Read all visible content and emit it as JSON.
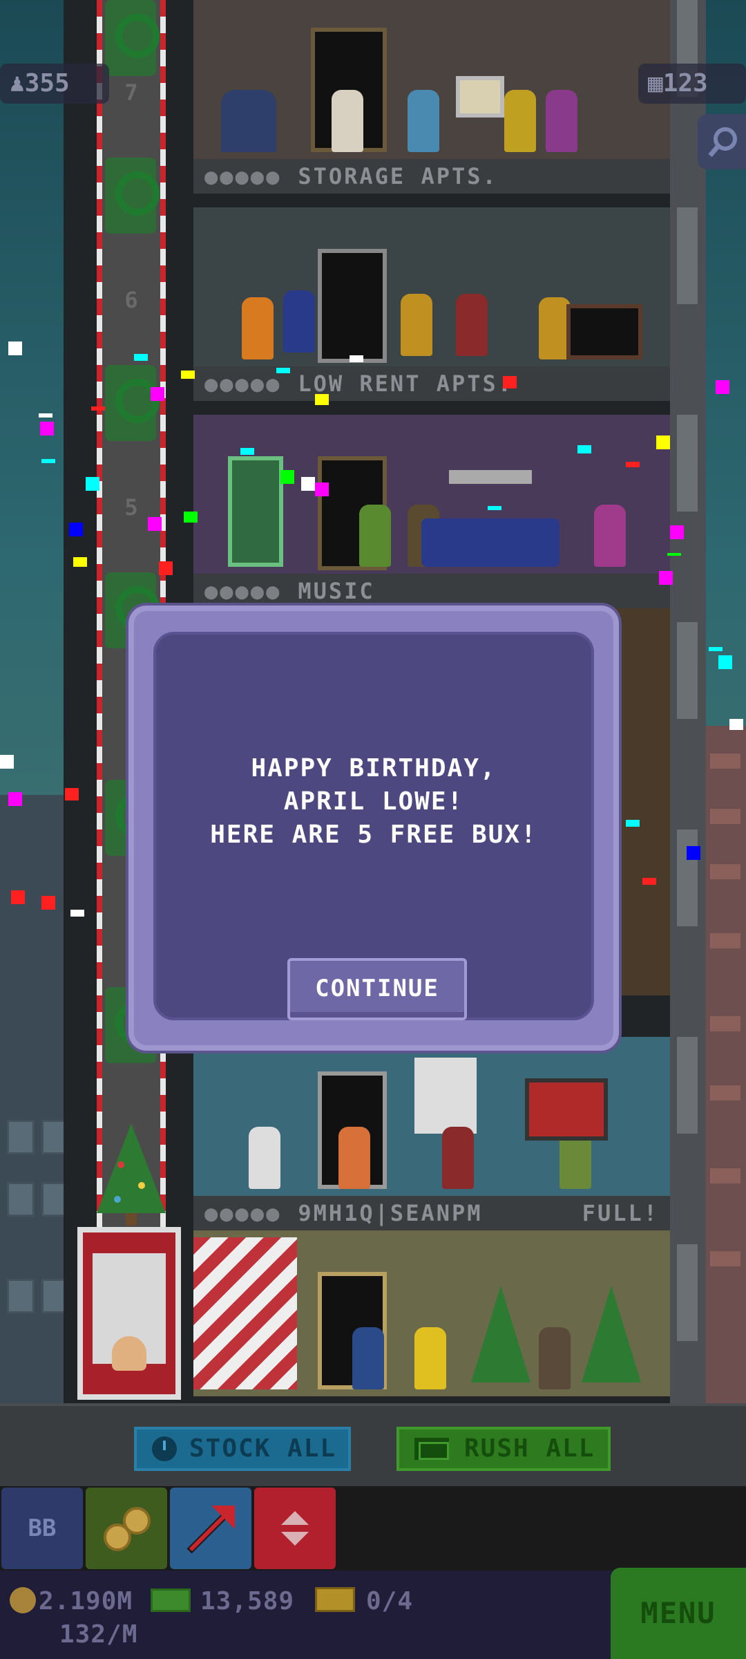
{
  "counters": {
    "population": "355",
    "floors": "123"
  },
  "shaft_numbers": [
    "7",
    "6",
    "5"
  ],
  "floors": [
    {
      "name": "STORAGE APTS.",
      "full": ""
    },
    {
      "name": "LOW RENT APTS.",
      "full": ""
    },
    {
      "name": "MUSIC",
      "full": ""
    },
    {
      "name": "9MH1Q|SEANPM",
      "full": "FULL!"
    }
  ],
  "modal": {
    "line1": "HAPPY BIRTHDAY,",
    "line2": "APRIL LOWE!",
    "line3": "HERE ARE 5 FREE BUX!",
    "continue_label": "CONTINUE"
  },
  "actions": {
    "stock_all_label": "STOCK ALL",
    "rush_all_label": "RUSH ALL"
  },
  "tabs": {
    "bb_label": "BB"
  },
  "status": {
    "coins": "2.190M",
    "coin_rate": "132/M",
    "bux": "13,589",
    "tickets": "0/4",
    "menu_label": "MENU"
  },
  "colors": {
    "modal_bg": "#4e4880",
    "modal_frame": "#8a82c0",
    "stock_button": "#1b6a8f",
    "rush_button": "#2d7a1f",
    "menu_button": "#2b7a22"
  }
}
